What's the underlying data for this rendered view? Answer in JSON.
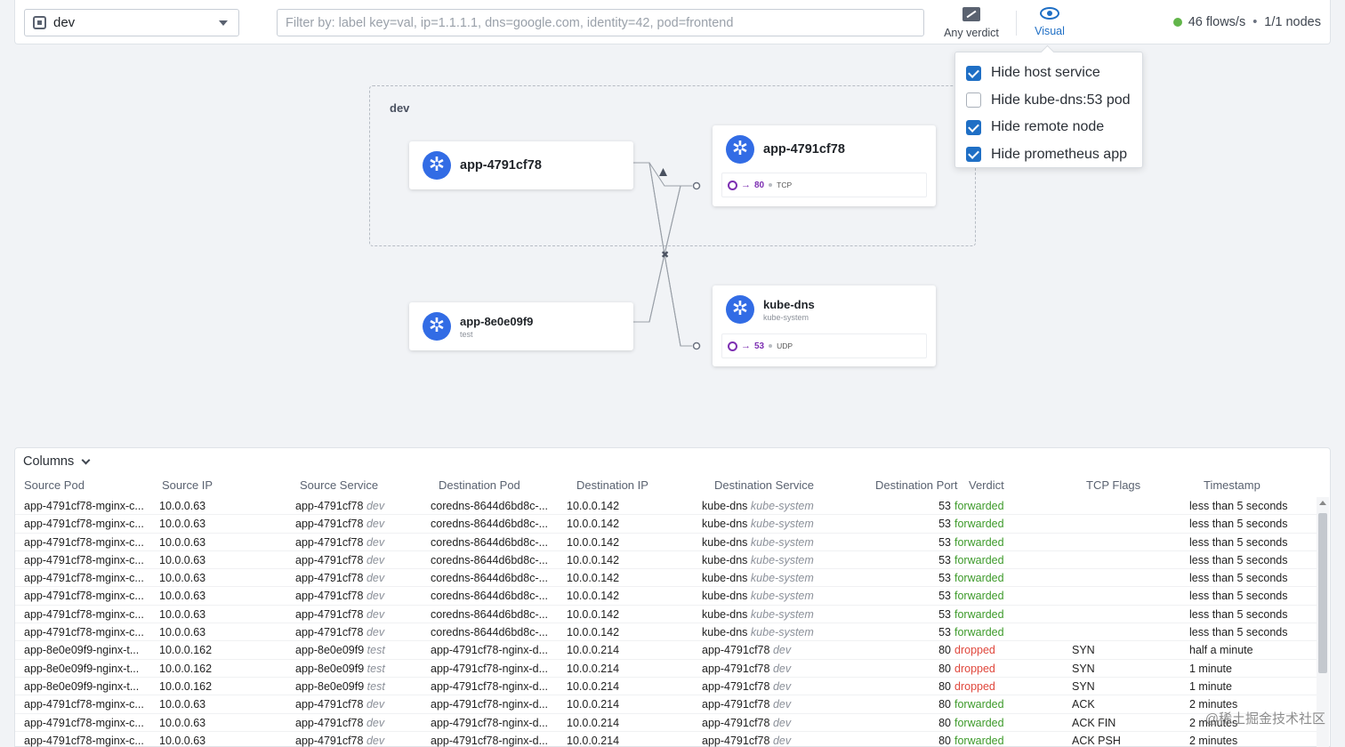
{
  "topbar": {
    "namespace": "dev",
    "filter_placeholder": "Filter by: label key=val, ip=1.1.1.1, dns=google.com, identity=42, pod=frontend",
    "verdict_label": "Any verdict",
    "visual_label": "Visual",
    "flows": "46 flows/s",
    "bullet": "•",
    "nodes": "1/1 nodes",
    "status_color": "#62b54a"
  },
  "visual_menu": [
    {
      "label": "Hide host service",
      "checked": true
    },
    {
      "label": "Hide kube-dns:53 pod",
      "checked": false
    },
    {
      "label": "Hide remote node",
      "checked": true
    },
    {
      "label": "Hide prometheus app",
      "checked": true
    }
  ],
  "map": {
    "namespace_box": "dev",
    "cards": [
      {
        "title": "app-4791cf78",
        "subtitle": ""
      },
      {
        "title": "app-4791cf78",
        "subtitle": "",
        "port": "80",
        "proto": "TCP"
      },
      {
        "title": "app-8e0e09f9",
        "subtitle": "test"
      },
      {
        "title": "kube-dns",
        "subtitle": "kube-system",
        "port": "53",
        "proto": "UDP"
      }
    ]
  },
  "table": {
    "columns_button": "Columns",
    "headers": [
      "Source Pod",
      "Source IP",
      "Source Service",
      "Destination Pod",
      "Destination IP",
      "Destination Service",
      "Destination Port",
      "Verdict",
      "TCP Flags",
      "Timestamp"
    ],
    "rows": [
      [
        "app-4791cf78-mginx-c...",
        "10.0.0.63",
        "app-4791cf78",
        "dev",
        "coredns-8644d6bd8c-...",
        "10.0.0.142",
        "kube-dns",
        "kube-system",
        "53",
        "forwarded",
        "",
        "less than 5 seconds"
      ],
      [
        "app-4791cf78-mginx-c...",
        "10.0.0.63",
        "app-4791cf78",
        "dev",
        "coredns-8644d6bd8c-...",
        "10.0.0.142",
        "kube-dns",
        "kube-system",
        "53",
        "forwarded",
        "",
        "less than 5 seconds"
      ],
      [
        "app-4791cf78-mginx-c...",
        "10.0.0.63",
        "app-4791cf78",
        "dev",
        "coredns-8644d6bd8c-...",
        "10.0.0.142",
        "kube-dns",
        "kube-system",
        "53",
        "forwarded",
        "",
        "less than 5 seconds"
      ],
      [
        "app-4791cf78-mginx-c...",
        "10.0.0.63",
        "app-4791cf78",
        "dev",
        "coredns-8644d6bd8c-...",
        "10.0.0.142",
        "kube-dns",
        "kube-system",
        "53",
        "forwarded",
        "",
        "less than 5 seconds"
      ],
      [
        "app-4791cf78-mginx-c...",
        "10.0.0.63",
        "app-4791cf78",
        "dev",
        "coredns-8644d6bd8c-...",
        "10.0.0.142",
        "kube-dns",
        "kube-system",
        "53",
        "forwarded",
        "",
        "less than 5 seconds"
      ],
      [
        "app-4791cf78-mginx-c...",
        "10.0.0.63",
        "app-4791cf78",
        "dev",
        "coredns-8644d6bd8c-...",
        "10.0.0.142",
        "kube-dns",
        "kube-system",
        "53",
        "forwarded",
        "",
        "less than 5 seconds"
      ],
      [
        "app-4791cf78-mginx-c...",
        "10.0.0.63",
        "app-4791cf78",
        "dev",
        "coredns-8644d6bd8c-...",
        "10.0.0.142",
        "kube-dns",
        "kube-system",
        "53",
        "forwarded",
        "",
        "less than 5 seconds"
      ],
      [
        "app-4791cf78-mginx-c...",
        "10.0.0.63",
        "app-4791cf78",
        "dev",
        "coredns-8644d6bd8c-...",
        "10.0.0.142",
        "kube-dns",
        "kube-system",
        "53",
        "forwarded",
        "",
        "less than 5 seconds"
      ],
      [
        "app-8e0e09f9-nginx-t...",
        "10.0.0.162",
        "app-8e0e09f9",
        "test",
        "app-4791cf78-nginx-d...",
        "10.0.0.214",
        "app-4791cf78",
        "dev",
        "80",
        "dropped",
        "SYN",
        "half a minute"
      ],
      [
        "app-8e0e09f9-nginx-t...",
        "10.0.0.162",
        "app-8e0e09f9",
        "test",
        "app-4791cf78-nginx-d...",
        "10.0.0.214",
        "app-4791cf78",
        "dev",
        "80",
        "dropped",
        "SYN",
        "1 minute"
      ],
      [
        "app-8e0e09f9-nginx-t...",
        "10.0.0.162",
        "app-8e0e09f9",
        "test",
        "app-4791cf78-nginx-d...",
        "10.0.0.214",
        "app-4791cf78",
        "dev",
        "80",
        "dropped",
        "SYN",
        "1 minute"
      ],
      [
        "app-4791cf78-mginx-c...",
        "10.0.0.63",
        "app-4791cf78",
        "dev",
        "app-4791cf78-nginx-d...",
        "10.0.0.214",
        "app-4791cf78",
        "dev",
        "80",
        "forwarded",
        "ACK",
        "2 minutes"
      ],
      [
        "app-4791cf78-mginx-c...",
        "10.0.0.63",
        "app-4791cf78",
        "dev",
        "app-4791cf78-nginx-d...",
        "10.0.0.214",
        "app-4791cf78",
        "dev",
        "80",
        "forwarded",
        "ACK FIN",
        "2 minutes"
      ],
      [
        "app-4791cf78-mginx-c...",
        "10.0.0.63",
        "app-4791cf78",
        "dev",
        "app-4791cf78-nginx-d...",
        "10.0.0.214",
        "app-4791cf78",
        "dev",
        "80",
        "forwarded",
        "ACK PSH",
        "2 minutes"
      ]
    ]
  },
  "colors": {
    "accent": "#1f6fc5",
    "forwarded": "#3d9a2a",
    "dropped": "#e0483d",
    "k8s": "#326ce5",
    "port": "#7d2fb2"
  },
  "watermark": "@稀土掘金技术社区"
}
